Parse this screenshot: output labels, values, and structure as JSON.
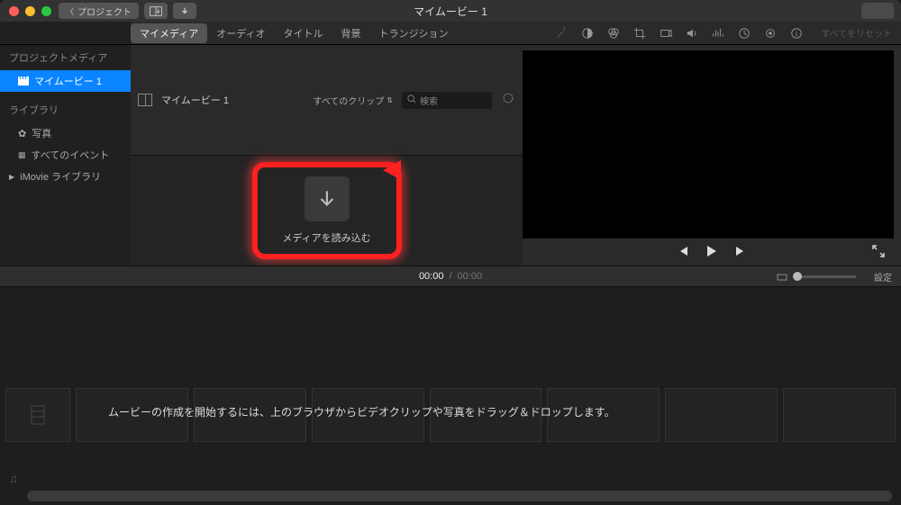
{
  "titlebar": {
    "back_label": "プロジェクト",
    "title": "マイムービー 1"
  },
  "tabs": {
    "items": [
      "マイメディア",
      "オーディオ",
      "タイトル",
      "背景",
      "トランジション"
    ],
    "active_index": 0
  },
  "inspector": {
    "reset_label": "すべてをリセット"
  },
  "sidebar": {
    "section1": "プロジェクトメディア",
    "items1": [
      "マイムービー 1"
    ],
    "section2": "ライブラリ",
    "items2": [
      "写真",
      "すべてのイベント"
    ],
    "imovie_lib": "iMovie ライブラリ"
  },
  "browser": {
    "title": "マイムービー 1",
    "clips_label": "すべてのクリップ",
    "search_placeholder": "検索",
    "import_label": "メディアを読み込む"
  },
  "timecode": {
    "current": "00:00",
    "total": "00:00",
    "settings": "設定"
  },
  "timeline": {
    "message": "ムービーの作成を開始するには、上のブラウザからビデオクリップや写真をドラッグ＆ドロップします。"
  }
}
